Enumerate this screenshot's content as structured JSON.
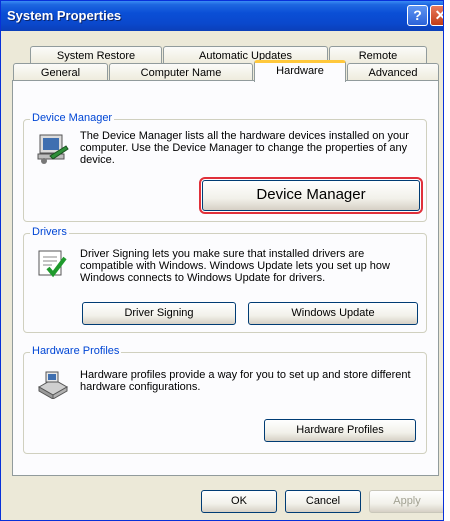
{
  "window": {
    "title": "System Properties"
  },
  "titlebar": {
    "help_glyph": "?",
    "close_glyph": "✕"
  },
  "tabs": {
    "row1": [
      "System Restore",
      "Automatic Updates",
      "Remote"
    ],
    "row2": [
      "General",
      "Computer Name",
      "Hardware",
      "Advanced"
    ],
    "active": "Hardware"
  },
  "device_manager": {
    "legend": "Device Manager",
    "description": "The Device Manager lists all the hardware devices installed on your computer. Use the Device Manager to change the properties of any device.",
    "button": "Device Manager",
    "icon": "device-manager-icon"
  },
  "drivers": {
    "legend": "Drivers",
    "description": "Driver Signing lets you make sure that installed drivers are compatible with Windows. Windows Update lets you set up how Windows connects to Windows Update for drivers.",
    "signing_button": "Driver Signing",
    "update_button": "Windows Update",
    "icon": "driver-signing-icon"
  },
  "hardware_profiles": {
    "legend": "Hardware Profiles",
    "description": "Hardware profiles provide a way for you to set up and store different hardware configurations.",
    "button": "Hardware Profiles",
    "icon": "hardware-profiles-icon"
  },
  "footer": {
    "ok": "OK",
    "cancel": "Cancel",
    "apply": "Apply"
  },
  "colors": {
    "title_bar": "#0a4fd6",
    "legend_text": "#0046d5",
    "highlight_outline": "#e0303a",
    "active_tab_accent": "#ffc83c"
  }
}
